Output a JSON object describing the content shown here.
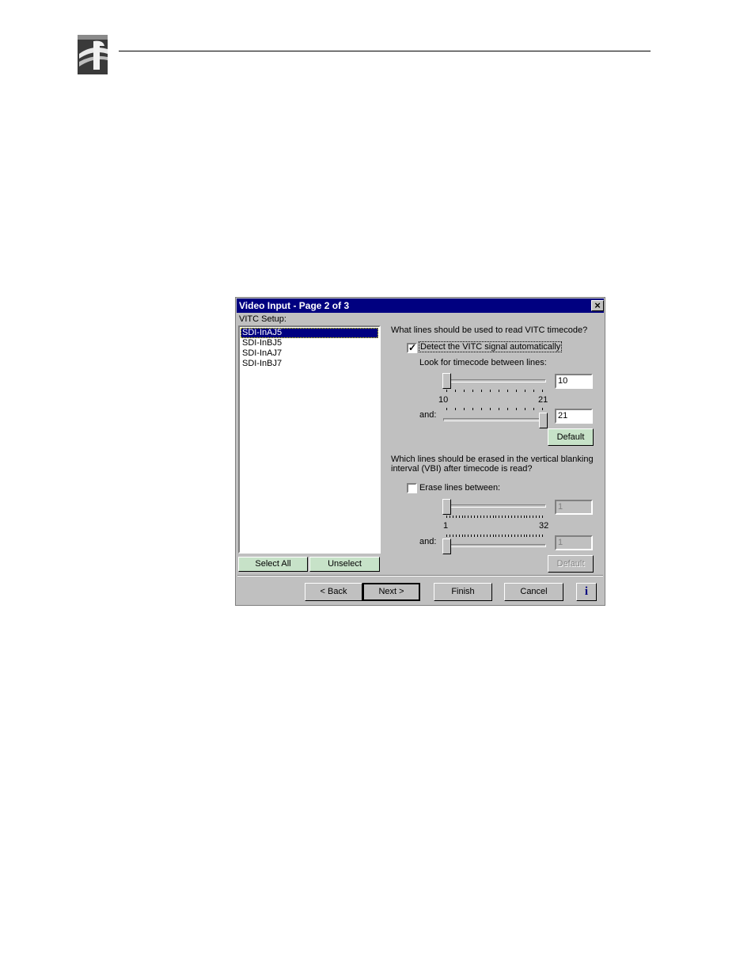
{
  "page": {
    "logo_icon": "company-logo-icon"
  },
  "dialog": {
    "title": "Video Input - Page 2 of 3",
    "close_icon": "close-x-icon",
    "vitc_label": "VITC Setup:",
    "list_items": [
      {
        "label": "SDI-InAJ5",
        "selected": true
      },
      {
        "label": "SDI-InBJ5",
        "selected": false
      },
      {
        "label": "SDI-InAJ7",
        "selected": false
      },
      {
        "label": "SDI-InBJ7",
        "selected": false
      }
    ],
    "select_all": "Select All",
    "unselect": "Unselect",
    "read": {
      "question": "What lines should be used to read VITC timecode?",
      "detect_label": "Detect the VITC signal automatically",
      "detect_checked": true,
      "look_label": "Look for timecode between lines:",
      "slider1_value": "10",
      "min_label": "10",
      "max_label": "21",
      "and_label": "and:",
      "slider2_value": "21",
      "range_min": 10,
      "range_max": 21,
      "default_label": "Default"
    },
    "erase": {
      "question_line1": "Which lines should be erased in the vertical blanking",
      "question_line2": "interval (VBI) after timecode is read?",
      "erase_label": "Erase lines between:",
      "erase_checked": false,
      "slider1_value": "1",
      "min_label": "1",
      "max_label": "32",
      "and_label": "and:",
      "slider2_value": "1",
      "range_min": 1,
      "range_max": 32,
      "default_label": "Default"
    },
    "buttons": {
      "back": "< Back",
      "next": "Next >",
      "finish": "Finish",
      "cancel": "Cancel",
      "info": "i"
    }
  }
}
